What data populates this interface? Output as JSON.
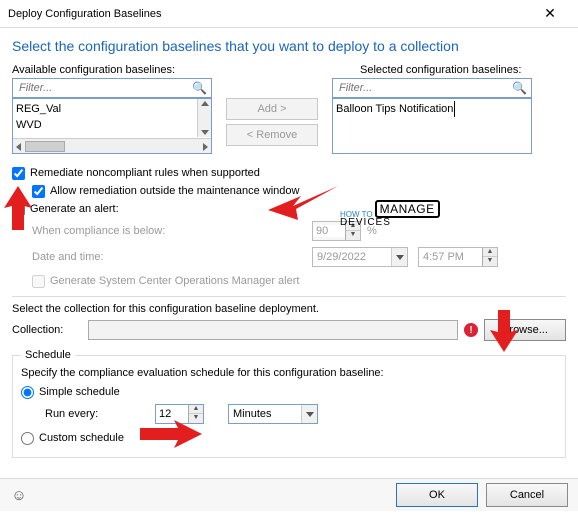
{
  "window": {
    "title": "Deploy Configuration Baselines",
    "close_glyph": "✕"
  },
  "header": {
    "title": "Select the configuration baselines that you want to deploy to a collection"
  },
  "lists": {
    "available_label": "Available configuration baselines:",
    "selected_label": "Selected configuration baselines:",
    "filter_placeholder": "Filter...",
    "search_glyph": "🔍",
    "available_items": [
      "REG_Val",
      "WVD"
    ],
    "selected_items": [
      "Balloon Tips Notification"
    ],
    "add_label": "Add >",
    "remove_label": "< Remove"
  },
  "options": {
    "remediate_label": "Remediate noncompliant rules when supported",
    "remediate_checked": true,
    "allow_outside_label": "Allow remediation outside the maintenance window",
    "allow_outside_checked": true,
    "generate_alert_label": "Generate an alert:",
    "generate_alert_checked": false,
    "compliance_label": "When compliance is below:",
    "compliance_value": "90",
    "compliance_suffix": "%",
    "datetime_label": "Date and time:",
    "date_value": "9/29/2022",
    "time_value": "4:57 PM",
    "scom_label": "Generate System Center Operations Manager alert"
  },
  "collection": {
    "heading": "Select the collection for this configuration baseline deployment.",
    "label": "Collection:",
    "error_glyph": "!",
    "browse_label": "Browse..."
  },
  "schedule": {
    "legend": "Schedule",
    "heading": "Specify the compliance evaluation schedule for this configuration baseline:",
    "simple_label": "Simple schedule",
    "simple_selected": true,
    "run_every_label": "Run every:",
    "run_every_value": "12",
    "run_every_unit": "Minutes",
    "custom_label": "Custom schedule"
  },
  "footer": {
    "ok_label": "OK",
    "cancel_label": "Cancel"
  },
  "overlay": {
    "howto": "HOW TO",
    "manage": "MANAGE",
    "devices": "DEVICES"
  }
}
